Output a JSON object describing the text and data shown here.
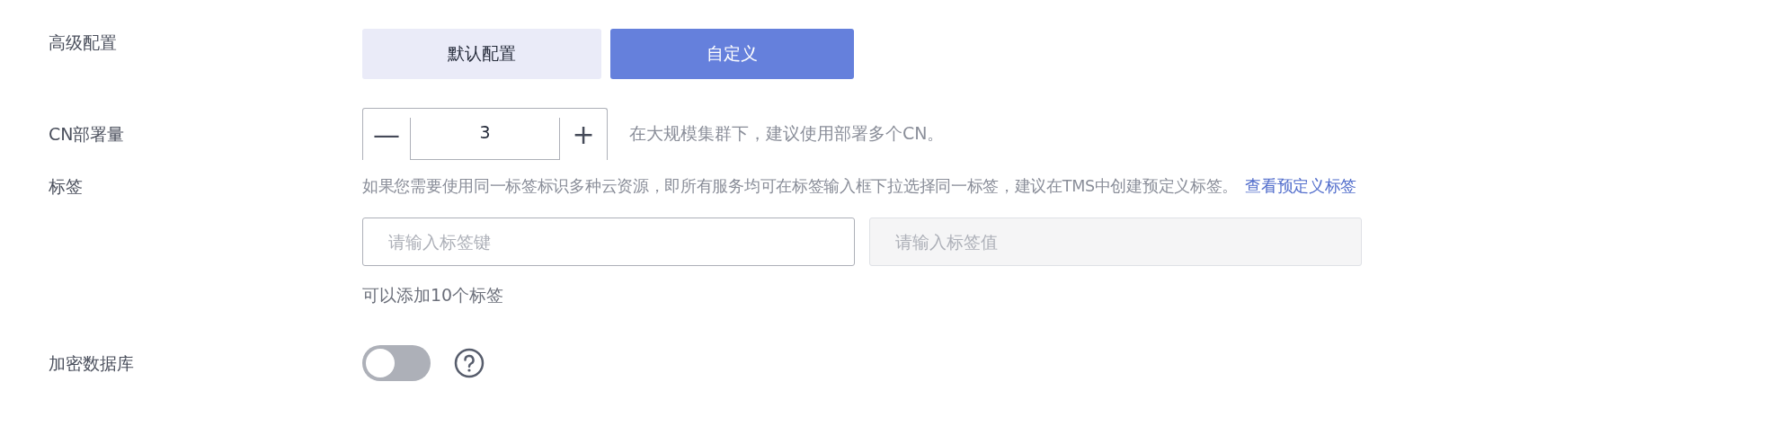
{
  "advanced": {
    "label": "高级配置",
    "options": [
      {
        "label": "默认配置",
        "selected": false
      },
      {
        "label": "自定义",
        "selected": true
      }
    ]
  },
  "cn": {
    "label": "CN部署量",
    "minus": "—",
    "value": "3",
    "plus": "+",
    "hint": "在大规模集群下，建议使用部署多个CN。"
  },
  "tags": {
    "label": "标签",
    "description": "如果您需要使用同一标签标识多种云资源，即所有服务均可在标签输入框下拉选择同一标签，建议在TMS中创建预定义标签。",
    "link": "查看预定义标签",
    "key_field": {
      "placeholder": "请输入标签键",
      "disabled": false
    },
    "value_field": {
      "placeholder": "请输入标签值",
      "disabled": true
    },
    "note": "可以添加10个标签"
  },
  "encrypt": {
    "label": "加密数据库",
    "on": false
  }
}
